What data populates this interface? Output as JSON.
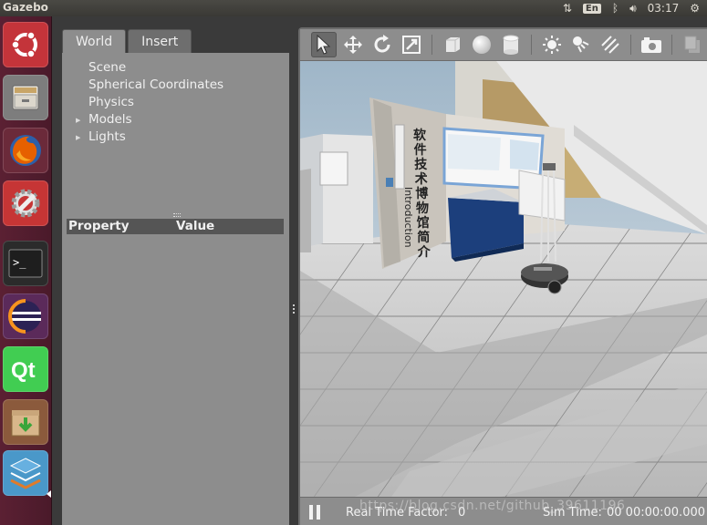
{
  "window": {
    "title": "Gazebo"
  },
  "tray": {
    "network_icon": "updown-arrows-icon",
    "keyboard": "En",
    "bluetooth_icon": "bluetooth-icon",
    "volume_icon": "volume-icon",
    "clock": "03:17",
    "power_icon": "gear-power-icon"
  },
  "launcher": {
    "items": [
      {
        "name": "ubuntu-dash",
        "icon": "ubuntu-icon",
        "color": "#c4343a"
      },
      {
        "name": "files",
        "icon": "file-cabinet-icon",
        "color": "#8a8a8a"
      },
      {
        "name": "firefox",
        "icon": "firefox-icon",
        "color": "#e66000"
      },
      {
        "name": "system-settings",
        "icon": "wrench-gear-icon",
        "color": "#c63535"
      },
      {
        "name": "terminal",
        "icon": "terminal-icon",
        "color": "#2b2b2b"
      },
      {
        "name": "eclipse",
        "icon": "eclipse-icon",
        "color": "#2c2255"
      },
      {
        "name": "qt-creator",
        "icon": "qt-icon",
        "color": "#41cd52"
      },
      {
        "name": "software-center",
        "icon": "package-download-icon",
        "color": "#c9a87a"
      },
      {
        "name": "workspaces",
        "icon": "stacked-layers-icon",
        "color": "#4a98c9"
      }
    ]
  },
  "left_panel": {
    "tabs": [
      {
        "label": "World",
        "active": true
      },
      {
        "label": "Insert",
        "active": false
      }
    ],
    "tree": [
      {
        "label": "Scene",
        "expandable": false
      },
      {
        "label": "Spherical Coordinates",
        "expandable": false
      },
      {
        "label": "Physics",
        "expandable": false
      },
      {
        "label": "Models",
        "expandable": true
      },
      {
        "label": "Lights",
        "expandable": true
      }
    ],
    "properties": {
      "col_property": "Property",
      "col_value": "Value"
    }
  },
  "toolbar": {
    "tools": [
      {
        "name": "select-mode",
        "icon": "arrow-pointer-icon",
        "selected": true
      },
      {
        "name": "translate-mode",
        "icon": "move-arrows-icon"
      },
      {
        "name": "rotate-mode",
        "icon": "rotate-icon"
      },
      {
        "name": "scale-mode",
        "icon": "scale-icon"
      },
      {
        "name": "box-shape",
        "icon": "box-icon"
      },
      {
        "name": "sphere-shape",
        "icon": "sphere-icon"
      },
      {
        "name": "cylinder-shape",
        "icon": "cylinder-icon"
      },
      {
        "name": "point-light",
        "icon": "sun-icon"
      },
      {
        "name": "spot-light",
        "icon": "spot-light-icon"
      },
      {
        "name": "directional-light",
        "icon": "directional-light-icon"
      },
      {
        "name": "screenshot",
        "icon": "camera-icon"
      },
      {
        "name": "copy",
        "icon": "copy-icon"
      }
    ]
  },
  "scene": {
    "panel_text_vertical": "软件技术博物馆简介",
    "panel_text_rotated": "Introduction"
  },
  "bottom_bar": {
    "rtf_label": "Real Time Factor:",
    "rtf_value": "0",
    "sim_label": "Sim Time:",
    "sim_value": "00 00:00:00.000",
    "watermark": "https://blog.csdn.net/github_39611196"
  }
}
